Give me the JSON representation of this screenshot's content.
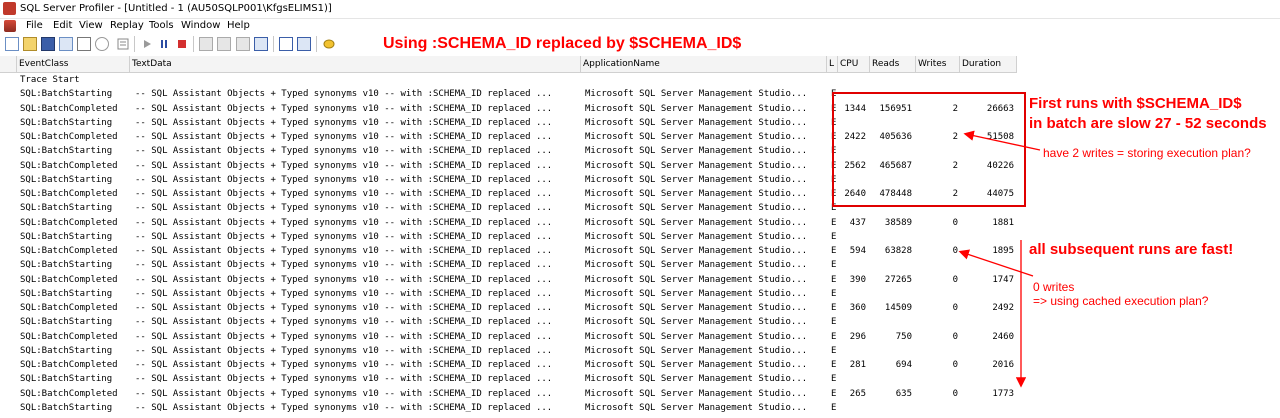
{
  "window": {
    "title": "SQL Server Profiler - [Untitled - 1 (AU50SQLP001\\KfgsELIMS1)]"
  },
  "menu": [
    "File",
    "Edit",
    "View",
    "Replay",
    "Tools",
    "Window",
    "Help"
  ],
  "toolbar": {
    "buttons": [
      "new-trace",
      "open",
      "save",
      "properties",
      "find",
      "clear",
      "start",
      "pause",
      "stop",
      "replay-step",
      "replay-breakpoint",
      "replay-cursor",
      "run-to-cursor",
      "template",
      "trace-properties",
      "help"
    ]
  },
  "annotations": {
    "top": "Using :SCHEMA_ID replaced by $SCHEMA_ID$",
    "first_runs_line1": "First runs with $SCHEMA_ID$",
    "first_runs_line2": "in batch  are slow 27 - 52 seconds",
    "two_writes": "have 2 writes = storing execution plan?",
    "fast": "all subsequent runs are fast!",
    "zero_writes_line1": "0 writes",
    "zero_writes_line2": "=> using cached execution plan?",
    "color": "#ff0000"
  },
  "columns": [
    "EventClass",
    "TextData",
    "ApplicationName",
    "L",
    "CPU",
    "Reads",
    "Writes",
    "Duration"
  ],
  "rows": [
    {
      "event": "Trace Start",
      "text": "",
      "app": "",
      "l": "",
      "cpu": "",
      "reads": "",
      "writes": "",
      "duration": ""
    },
    {
      "event": "SQL:BatchStarting",
      "text": "-- SQL Assistant Objects  + Typed synonyms v10  -- with :SCHEMA_ID replaced ...",
      "app": "Microsoft SQL Server Management Studio...",
      "l": "E",
      "cpu": "",
      "reads": "",
      "writes": "",
      "duration": ""
    },
    {
      "event": "SQL:BatchCompleted",
      "text": "-- SQL Assistant Objects  + Typed synonyms v10  -- with :SCHEMA_ID replaced ...",
      "app": "Microsoft SQL Server Management Studio...",
      "l": "E",
      "cpu": "1344",
      "reads": "156951",
      "writes": "2",
      "duration": "26663"
    },
    {
      "event": "SQL:BatchStarting",
      "text": "-- SQL Assistant Objects  + Typed synonyms v10  -- with :SCHEMA_ID replaced ...",
      "app": "Microsoft SQL Server Management Studio...",
      "l": "E",
      "cpu": "",
      "reads": "",
      "writes": "",
      "duration": ""
    },
    {
      "event": "SQL:BatchCompleted",
      "text": "-- SQL Assistant Objects  + Typed synonyms v10  -- with :SCHEMA_ID replaced ...",
      "app": "Microsoft SQL Server Management Studio...",
      "l": "E",
      "cpu": "2422",
      "reads": "405636",
      "writes": "2",
      "duration": "51508"
    },
    {
      "event": "SQL:BatchStarting",
      "text": "-- SQL Assistant Objects  + Typed synonyms v10  -- with :SCHEMA_ID replaced ...",
      "app": "Microsoft SQL Server Management Studio...",
      "l": "E",
      "cpu": "",
      "reads": "",
      "writes": "",
      "duration": ""
    },
    {
      "event": "SQL:BatchCompleted",
      "text": "-- SQL Assistant Objects  + Typed synonyms v10  -- with :SCHEMA_ID replaced ...",
      "app": "Microsoft SQL Server Management Studio...",
      "l": "E",
      "cpu": "2562",
      "reads": "465687",
      "writes": "2",
      "duration": "40226"
    },
    {
      "event": "SQL:BatchStarting",
      "text": "-- SQL Assistant Objects  + Typed synonyms v10  -- with :SCHEMA_ID replaced ...",
      "app": "Microsoft SQL Server Management Studio...",
      "l": "E",
      "cpu": "",
      "reads": "",
      "writes": "",
      "duration": ""
    },
    {
      "event": "SQL:BatchCompleted",
      "text": "-- SQL Assistant Objects  + Typed synonyms v10  -- with :SCHEMA_ID replaced ...",
      "app": "Microsoft SQL Server Management Studio...",
      "l": "E",
      "cpu": "2640",
      "reads": "478448",
      "writes": "2",
      "duration": "44075"
    },
    {
      "event": "SQL:BatchStarting",
      "text": "-- SQL Assistant Objects  + Typed synonyms v10  -- with :SCHEMA_ID replaced ...",
      "app": "Microsoft SQL Server Management Studio...",
      "l": "E",
      "cpu": "",
      "reads": "",
      "writes": "",
      "duration": ""
    },
    {
      "event": "SQL:BatchCompleted",
      "text": "-- SQL Assistant Objects  + Typed synonyms v10  -- with :SCHEMA_ID replaced ...",
      "app": "Microsoft SQL Server Management Studio...",
      "l": "E",
      "cpu": "437",
      "reads": "38589",
      "writes": "0",
      "duration": "1881"
    },
    {
      "event": "SQL:BatchStarting",
      "text": "-- SQL Assistant Objects  + Typed synonyms v10  -- with :SCHEMA_ID replaced ...",
      "app": "Microsoft SQL Server Management Studio...",
      "l": "E",
      "cpu": "",
      "reads": "",
      "writes": "",
      "duration": ""
    },
    {
      "event": "SQL:BatchCompleted",
      "text": "-- SQL Assistant Objects  + Typed synonyms v10  -- with :SCHEMA_ID replaced ...",
      "app": "Microsoft SQL Server Management Studio...",
      "l": "E",
      "cpu": "594",
      "reads": "63828",
      "writes": "0",
      "duration": "1895"
    },
    {
      "event": "SQL:BatchStarting",
      "text": "-- SQL Assistant Objects  + Typed synonyms v10  -- with :SCHEMA_ID replaced ...",
      "app": "Microsoft SQL Server Management Studio...",
      "l": "E",
      "cpu": "",
      "reads": "",
      "writes": "",
      "duration": ""
    },
    {
      "event": "SQL:BatchCompleted",
      "text": "-- SQL Assistant Objects  + Typed synonyms v10  -- with :SCHEMA_ID replaced ...",
      "app": "Microsoft SQL Server Management Studio...",
      "l": "E",
      "cpu": "390",
      "reads": "27265",
      "writes": "0",
      "duration": "1747"
    },
    {
      "event": "SQL:BatchStarting",
      "text": "-- SQL Assistant Objects  + Typed synonyms v10  -- with :SCHEMA_ID replaced ...",
      "app": "Microsoft SQL Server Management Studio...",
      "l": "E",
      "cpu": "",
      "reads": "",
      "writes": "",
      "duration": ""
    },
    {
      "event": "SQL:BatchCompleted",
      "text": "-- SQL Assistant Objects  + Typed synonyms v10  -- with :SCHEMA_ID replaced ...",
      "app": "Microsoft SQL Server Management Studio...",
      "l": "E",
      "cpu": "360",
      "reads": "14509",
      "writes": "0",
      "duration": "2492"
    },
    {
      "event": "SQL:BatchStarting",
      "text": "-- SQL Assistant Objects  + Typed synonyms v10  -- with :SCHEMA_ID replaced ...",
      "app": "Microsoft SQL Server Management Studio...",
      "l": "E",
      "cpu": "",
      "reads": "",
      "writes": "",
      "duration": ""
    },
    {
      "event": "SQL:BatchCompleted",
      "text": "-- SQL Assistant Objects  + Typed synonyms v10  -- with :SCHEMA_ID replaced ...",
      "app": "Microsoft SQL Server Management Studio...",
      "l": "E",
      "cpu": "296",
      "reads": "750",
      "writes": "0",
      "duration": "2460"
    },
    {
      "event": "SQL:BatchStarting",
      "text": "-- SQL Assistant Objects  + Typed synonyms v10  -- with :SCHEMA_ID replaced ...",
      "app": "Microsoft SQL Server Management Studio...",
      "l": "E",
      "cpu": "",
      "reads": "",
      "writes": "",
      "duration": ""
    },
    {
      "event": "SQL:BatchCompleted",
      "text": "-- SQL Assistant Objects  + Typed synonyms v10  -- with :SCHEMA_ID replaced ...",
      "app": "Microsoft SQL Server Management Studio...",
      "l": "E",
      "cpu": "281",
      "reads": "694",
      "writes": "0",
      "duration": "2016"
    },
    {
      "event": "SQL:BatchStarting",
      "text": "-- SQL Assistant Objects  + Typed synonyms v10  -- with :SCHEMA_ID replaced ...",
      "app": "Microsoft SQL Server Management Studio...",
      "l": "E",
      "cpu": "",
      "reads": "",
      "writes": "",
      "duration": ""
    },
    {
      "event": "SQL:BatchCompleted",
      "text": "-- SQL Assistant Objects  + Typed synonyms v10  -- with :SCHEMA_ID replaced ...",
      "app": "Microsoft SQL Server Management Studio...",
      "l": "E",
      "cpu": "265",
      "reads": "635",
      "writes": "0",
      "duration": "1773"
    },
    {
      "event": "SQL:BatchStarting",
      "text": "-- SQL Assistant Objects  + Typed synonyms v10  -- with :SCHEMA_ID replaced ...",
      "app": "Microsoft SQL Server Management Studio...",
      "l": "E",
      "cpu": "",
      "reads": "",
      "writes": "",
      "duration": ""
    }
  ]
}
